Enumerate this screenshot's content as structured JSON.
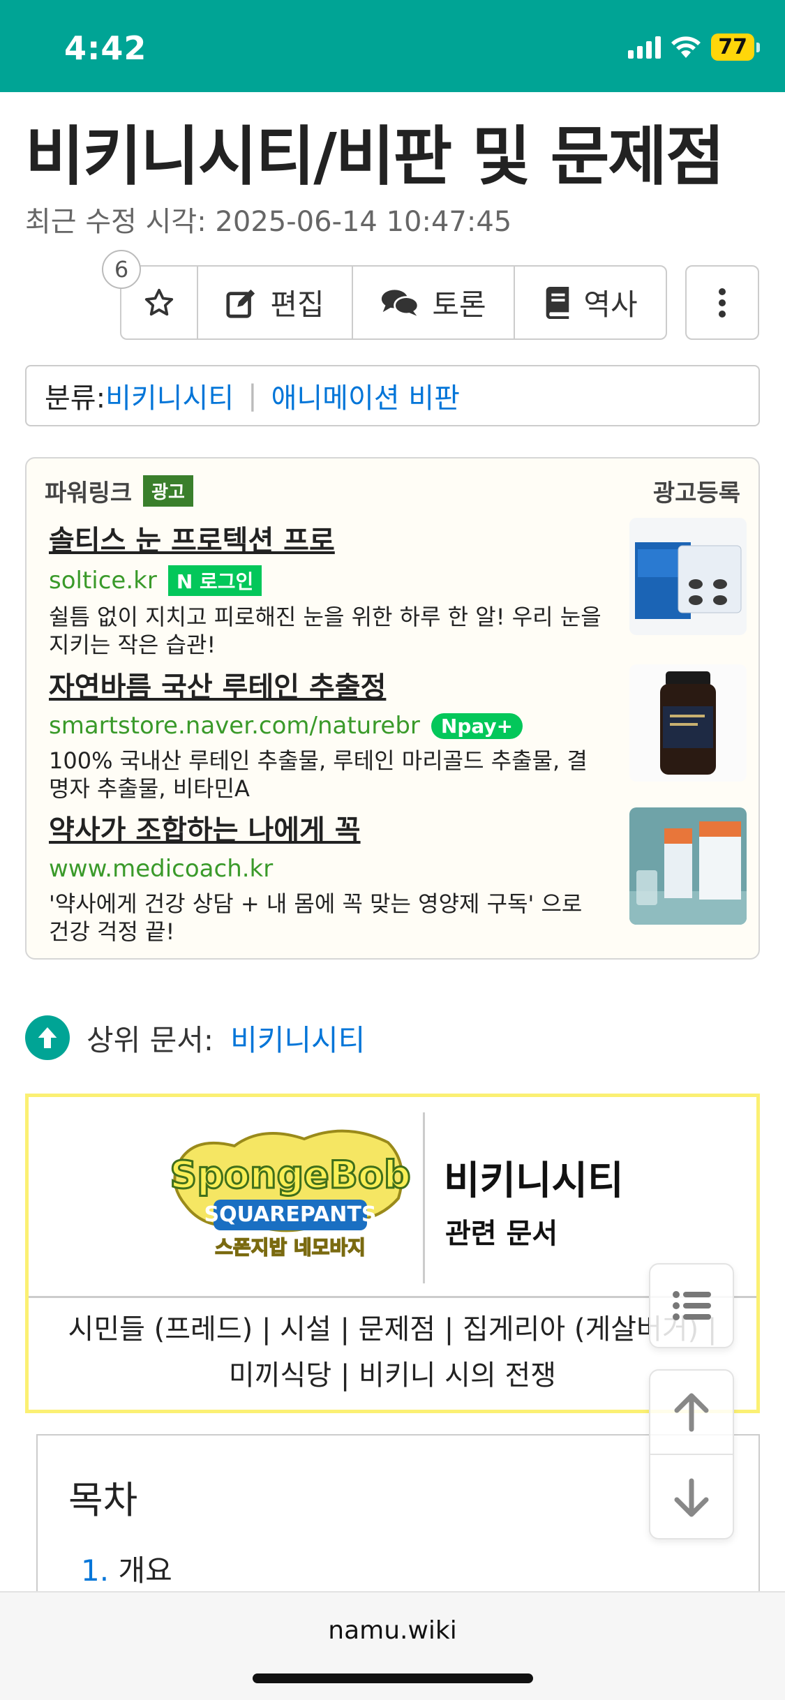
{
  "status_bar": {
    "time": "4:42",
    "battery": "77"
  },
  "page": {
    "title": "비키니시티/비판 및 문제점",
    "modified": "최근 수정 시각: 2025-06-14 10:47:45"
  },
  "toolbar": {
    "star_count": "6",
    "edit_label": "편집",
    "discuss_label": "토론",
    "history_label": "역사"
  },
  "category": {
    "label": "분류:",
    "items": [
      "비키니시티",
      "애니메이션 비판"
    ]
  },
  "ads": {
    "header": "파워링크",
    "badge": "광고",
    "register": "광고등록",
    "items": [
      {
        "title": "솔티스 눈 프로텍션 프로",
        "url": "soltice.kr",
        "tag": "N 로그인",
        "desc": "쉴틈 없이 지치고 피로해진 눈을 위한 하루 한 알! 우리 눈을 지키는 작은 습관!"
      },
      {
        "title": "자연바름 국산 루테인 추출정",
        "url": "smartstore.naver.com/naturebr",
        "tag": "Npay+",
        "desc": "100% 국내산 루테인 추출물, 루테인 마리골드 추출물, 결명자 추출물, 비타민A"
      },
      {
        "title": "약사가 조합하는 나에게 꼭",
        "url": "www.medicoach.kr",
        "tag": "",
        "desc": "'약사에게 건강 상담 + 내 몸에 꼭 맞는 영양제 구독' 으로 건강 걱정 끝!"
      }
    ]
  },
  "parent_doc": {
    "label": "상위 문서:",
    "link": "비키니시티"
  },
  "navbox": {
    "title": "비키니시티",
    "subtitle": "관련 문서",
    "links_line1": "시민들 (프레드) | 시설 | 문제점 | 집게리아 (게살버거) |",
    "links_line2": "미끼식당 | 비키니 시의 전쟁"
  },
  "toc": {
    "title": "목차",
    "items": [
      {
        "num": "1.",
        "label": "개요"
      }
    ]
  },
  "browser": {
    "url": "namu.wiki"
  },
  "colors": {
    "brand": "#00a495",
    "link": "#0275d8",
    "navbox_border": "#fbf073"
  }
}
